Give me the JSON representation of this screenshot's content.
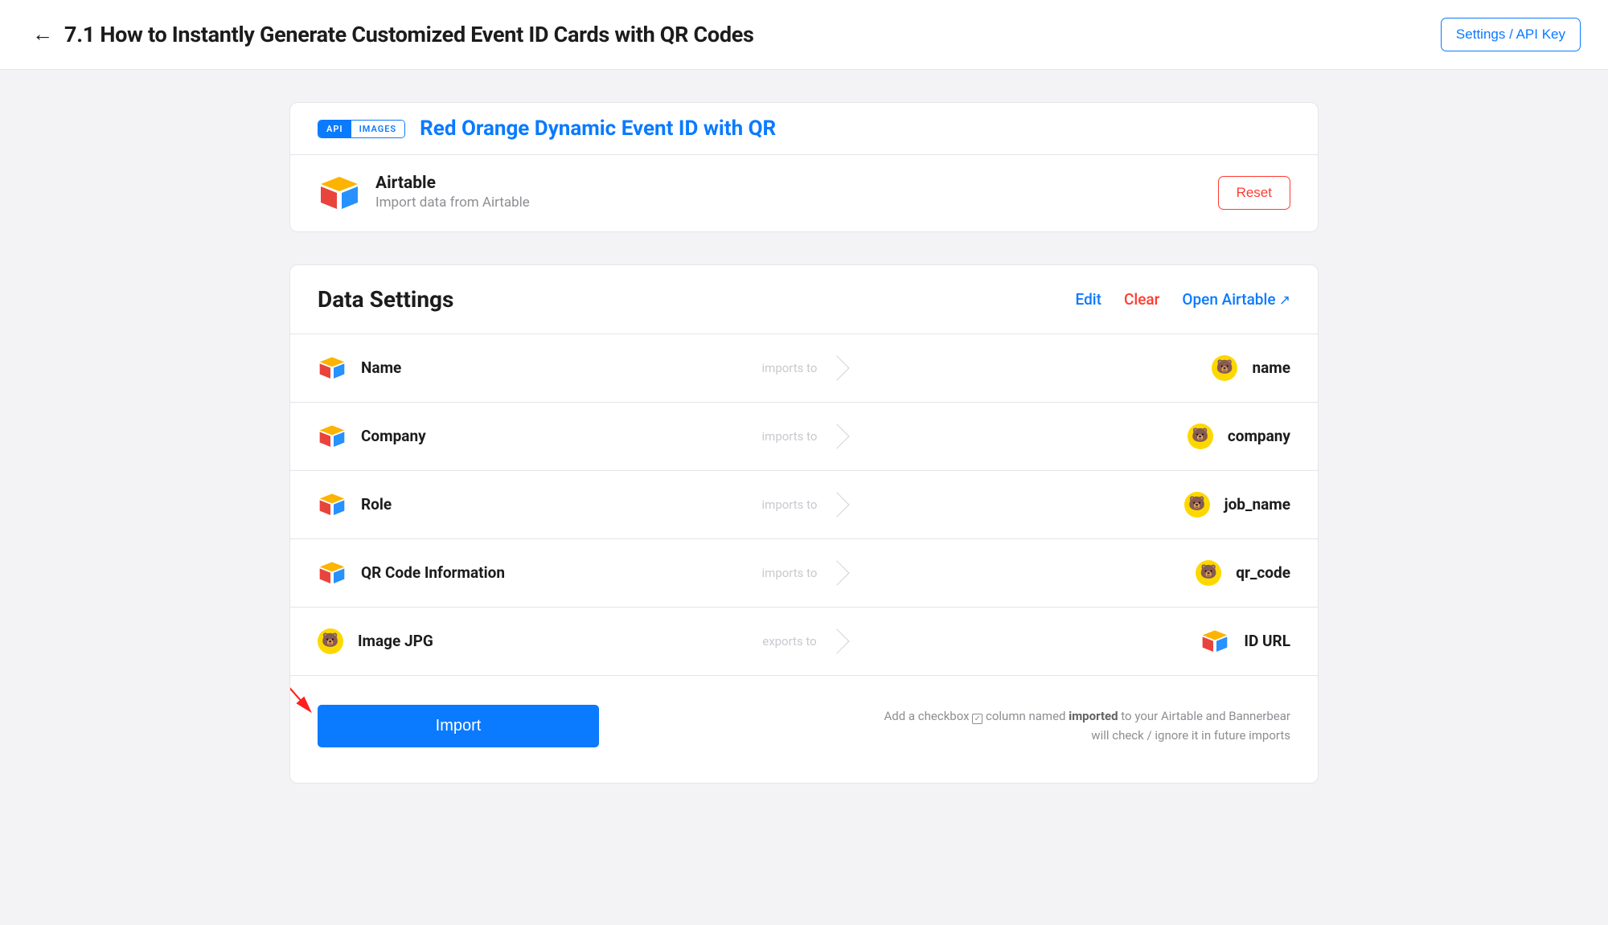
{
  "header": {
    "title": "7.1 How to Instantly Generate Customized Event ID Cards with QR Codes",
    "settings_label": "Settings / API Key"
  },
  "template": {
    "pill_left": "API",
    "pill_right": "IMAGES",
    "name": "Red Orange Dynamic Event ID with QR"
  },
  "integration": {
    "name": "Airtable",
    "subtitle": "Import data from Airtable",
    "reset_label": "Reset"
  },
  "data_settings": {
    "title": "Data Settings",
    "edit": "Edit",
    "clear": "Clear",
    "open": "Open Airtable",
    "mappings": [
      {
        "src": "Name",
        "verb": "imports to",
        "dst": "name",
        "src_type": "airtable",
        "dst_type": "bannerbear"
      },
      {
        "src": "Company",
        "verb": "imports to",
        "dst": "company",
        "src_type": "airtable",
        "dst_type": "bannerbear"
      },
      {
        "src": "Role",
        "verb": "imports to",
        "dst": "job_name",
        "src_type": "airtable",
        "dst_type": "bannerbear"
      },
      {
        "src": "QR Code Information",
        "verb": "imports to",
        "dst": "qr_code",
        "src_type": "airtable",
        "dst_type": "bannerbear"
      },
      {
        "src": "Image JPG",
        "verb": "exports to",
        "dst": "ID URL",
        "src_type": "bannerbear",
        "dst_type": "airtable"
      }
    ]
  },
  "footer": {
    "import_label": "Import",
    "note_pre": "Add a checkbox ",
    "note_mid": " column named ",
    "note_bold": "imported",
    "note_post": " to your Airtable and Bannerbear will check / ignore it in future imports"
  }
}
